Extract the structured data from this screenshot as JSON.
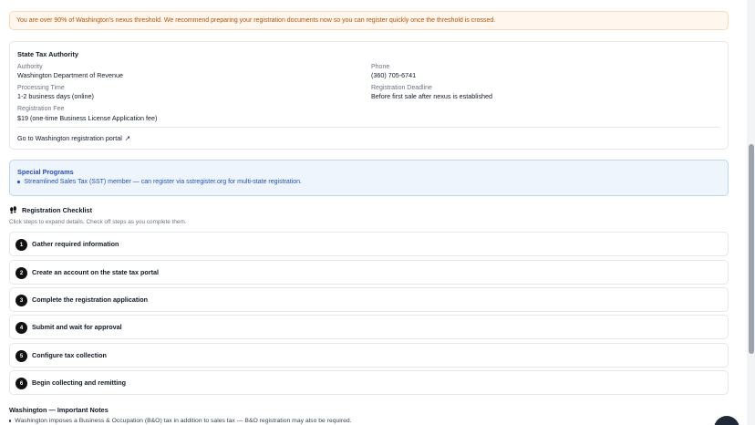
{
  "warning": "You are over 90% of Washington's nexus threshold. We recommend preparing your registration documents now so you can register quickly once the threshold is crossed.",
  "authority_card": {
    "title": "State Tax Authority",
    "authority_label": "Authority",
    "authority_value": "Washington Department of Revenue",
    "phone_label": "Phone",
    "phone_value": "(360) 705-6741",
    "processing_label": "Processing Time",
    "processing_value": "1-2 business days (online)",
    "deadline_label": "Registration Deadline",
    "deadline_value": "Before first sale after nexus is established",
    "fee_label": "Registration Fee",
    "fee_value": "$19 (one-time Business License Application fee)",
    "portal_link": "Go to Washington registration portal",
    "portal_icon": "external-link-icon"
  },
  "special_programs": {
    "title": "Special Programs",
    "items": [
      "Streamlined Sales Tax (SST) member — can register via sstregister.org for multi-state registration."
    ]
  },
  "checklist": {
    "title": "Registration Checklist",
    "icon": "footprints-icon",
    "subtitle": "Click steps to expand details. Check off steps as you complete them.",
    "steps": [
      {
        "num": "1",
        "label": "Gather required information"
      },
      {
        "num": "2",
        "label": "Create an account on the state tax portal"
      },
      {
        "num": "3",
        "label": "Complete the registration application"
      },
      {
        "num": "4",
        "label": "Submit and wait for approval"
      },
      {
        "num": "5",
        "label": "Configure tax collection"
      },
      {
        "num": "6",
        "label": "Begin collecting and remitting"
      }
    ]
  },
  "notes": {
    "title": "Washington — Important Notes",
    "items": [
      "Washington imposes a Business & Occupation (B&O) tax in addition to sales tax — B&O registration may also be required."
    ]
  },
  "colors": {
    "warning_bg": "#fff7ed",
    "warning_text": "#b45309",
    "info_bg": "#eef5fd",
    "info_text": "#1d4ed8",
    "step_badge": "#111111"
  }
}
